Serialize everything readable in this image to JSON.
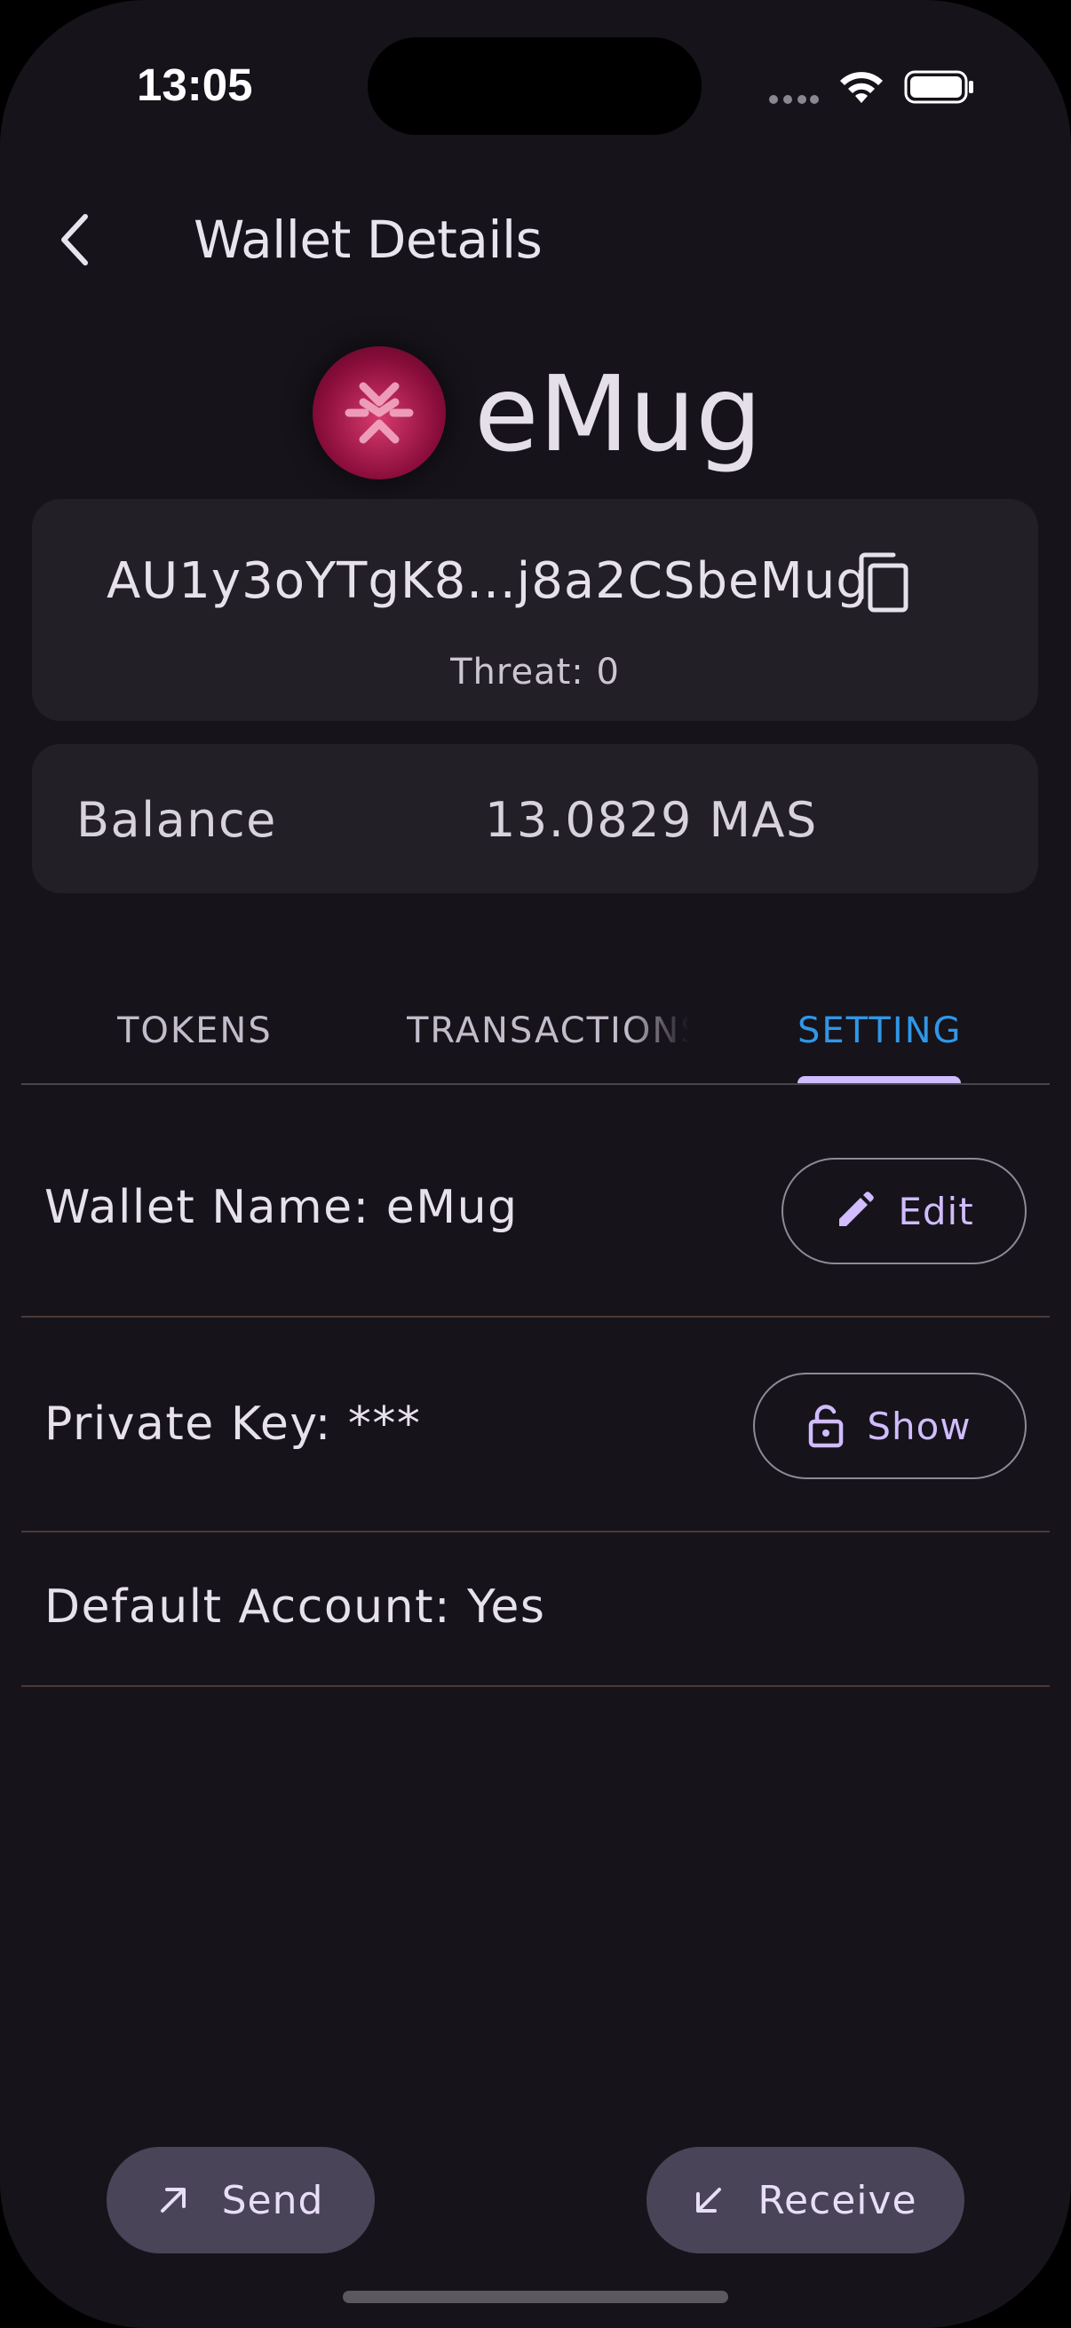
{
  "status_bar": {
    "time": "13:05",
    "signal_icon": "dots-icon",
    "wifi_icon": "wifi-icon",
    "battery_icon": "battery-icon"
  },
  "header": {
    "title": "Wallet Details",
    "back_icon": "chevron-left-icon"
  },
  "wallet": {
    "name": "eMug",
    "avatar_icon": "massa-logo-icon",
    "address": "AU1y3oYTgK8...j8a2CSbeMug",
    "threat": "Threat: 0",
    "balance_label": "Balance",
    "balance_value": "13.0829 MAS"
  },
  "tabs": [
    {
      "label": "TOKENS",
      "active": false
    },
    {
      "label": "TRANSACTIONS",
      "active": false
    },
    {
      "label": "SETTING",
      "active": true
    }
  ],
  "settings": {
    "wallet_name": "Wallet Name: eMug",
    "edit_label": "Edit",
    "private_key": "Private Key: ***",
    "show_label": "Show",
    "default_account": "Default Account: Yes"
  },
  "actions": {
    "send_label": "Send",
    "receive_label": "Receive"
  },
  "colors": {
    "background": "#16131a",
    "card": "#221f26",
    "active_tab": "#2f97e8",
    "tab_indicator": "#d0bcff",
    "pill": "#4a4458",
    "accent_text": "#d0bcff"
  }
}
